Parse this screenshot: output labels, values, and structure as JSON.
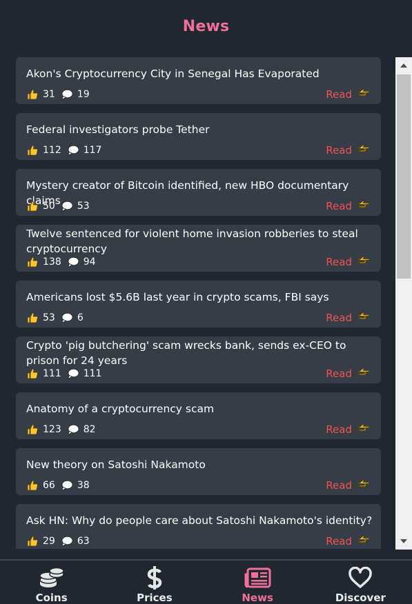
{
  "page": {
    "title": "News"
  },
  "colors": {
    "accent": "#f0709a",
    "read": "#ef5350",
    "background": "#212730",
    "card": "#363d46",
    "emoji": "#f7c53b"
  },
  "news": [
    {
      "title": "Akon's Cryptocurrency City in Senegal Has Evaporated",
      "likes": "31",
      "comments": "19",
      "read": "Read"
    },
    {
      "title": "Federal investigators probe Tether",
      "likes": "112",
      "comments": "117",
      "read": "Read"
    },
    {
      "title": "Mystery creator of Bitcoin identified, new HBO documentary claims",
      "likes": "50",
      "comments": "53",
      "read": "Read"
    },
    {
      "title": "Twelve sentenced for violent home invasion robberies to steal cryptocurrency",
      "likes": "138",
      "comments": "94",
      "read": "Read"
    },
    {
      "title": "Americans lost $5.6B last year in crypto scams, FBI says",
      "likes": "53",
      "comments": "6",
      "read": "Read"
    },
    {
      "title": "Crypto 'pig butchering' scam wrecks bank, sends ex-CEO to prison for 24 years",
      "likes": "111",
      "comments": "111",
      "read": "Read"
    },
    {
      "title": "Anatomy of a cryptocurrency scam",
      "likes": "123",
      "comments": "82",
      "read": "Read"
    },
    {
      "title": "New theory on Satoshi Nakamoto",
      "likes": "66",
      "comments": "38",
      "read": "Read"
    },
    {
      "title": "Ask HN: Why do people care about Satoshi Nakamoto's identity?",
      "likes": "29",
      "comments": "63",
      "read": "Read"
    }
  ],
  "nav": [
    {
      "label": "Coins",
      "icon": "coins-icon"
    },
    {
      "label": "Prices",
      "icon": "dollar-icon"
    },
    {
      "label": "News",
      "icon": "newspaper-icon",
      "active": true
    },
    {
      "label": "Discover",
      "icon": "heart-icon"
    }
  ]
}
